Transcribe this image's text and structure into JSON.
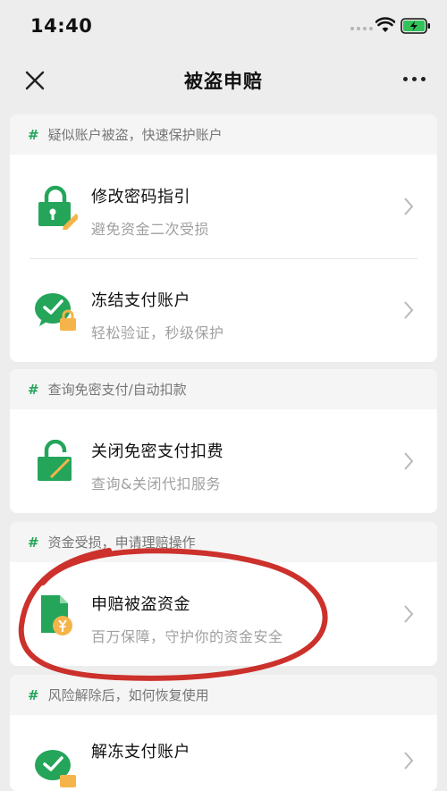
{
  "status_bar": {
    "time": "14:40"
  },
  "nav": {
    "title": "被盗申赔"
  },
  "sections": [
    {
      "header": "疑似账户被盗，快速保护账户",
      "items": [
        {
          "title": "修改密码指引",
          "subtitle": "避免资金二次受损",
          "icon": "lock-pen-icon"
        },
        {
          "title": "冻结支付账户",
          "subtitle": "轻松验证，秒级保护",
          "icon": "wechat-pay-lock-icon"
        }
      ]
    },
    {
      "header": "查询免密支付/自动扣款",
      "items": [
        {
          "title": "关闭免密支付扣费",
          "subtitle": "查询&关闭代扣服务",
          "icon": "open-lock-icon"
        }
      ]
    },
    {
      "header": "资金受损，申请理赔操作",
      "items": [
        {
          "title": "申赔被盗资金",
          "subtitle": "百万保障，守护你的资金安全",
          "icon": "claim-document-icon"
        }
      ]
    },
    {
      "header": "风险解除后，如何恢复使用",
      "items": [
        {
          "title": "解冻支付账户",
          "subtitle": "",
          "icon": "unfreeze-account-icon"
        }
      ]
    }
  ],
  "colors": {
    "accent": "#25a55a",
    "background": "#ededed",
    "annotation": "#c8201a"
  }
}
